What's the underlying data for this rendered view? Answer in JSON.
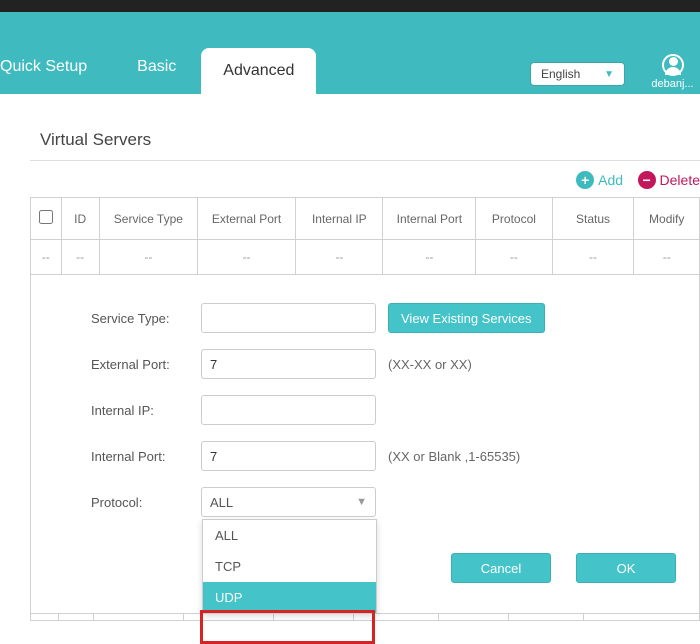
{
  "nav": {
    "quick_setup": "Quick Setup",
    "basic": "Basic",
    "advanced": "Advanced",
    "language": "English",
    "username": "debanj..."
  },
  "page_title": "Virtual Servers",
  "actions": {
    "add": "Add",
    "delete": "Delete"
  },
  "table": {
    "headers": {
      "id": "ID",
      "service_type": "Service Type",
      "external_port": "External Port",
      "internal_ip": "Internal IP",
      "internal_port": "Internal Port",
      "protocol": "Protocol",
      "status": "Status",
      "modify": "Modify"
    },
    "empty_cell": "--"
  },
  "form": {
    "labels": {
      "service_type": "Service Type:",
      "external_port": "External Port:",
      "internal_ip": "Internal IP:",
      "internal_port": "Internal Port:",
      "protocol": "Protocol:"
    },
    "values": {
      "service_type": "",
      "external_port": "7",
      "internal_ip": "",
      "internal_port": "7",
      "protocol_selected": "ALL"
    },
    "hints": {
      "external_port": "(XX-XX or XX)",
      "internal_port": "(XX or Blank ,1-65535)"
    },
    "buttons": {
      "view_existing": "View Existing Services",
      "cancel": "Cancel",
      "ok": "OK"
    },
    "protocol_options": [
      "ALL",
      "TCP",
      "UDP"
    ]
  }
}
